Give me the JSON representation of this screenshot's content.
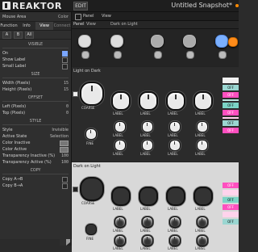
{
  "app": {
    "name": "REAKTOR",
    "edit_label": "EDIT",
    "snapshot_title": "Untitled Snapshot*"
  },
  "left_panel": {
    "header_left": "Mouse Area",
    "header_right": "Color",
    "tabs": [
      "Function",
      "Info",
      "View",
      "Connect"
    ],
    "active_tab": "View",
    "buttons": [
      "A",
      "B",
      "All"
    ],
    "sections": {
      "visible": "VISIBLE",
      "size": "SIZE",
      "offset": "OFFSET",
      "style": "STYLE",
      "copy": "COPY"
    },
    "visible_rows": [
      {
        "label": "On",
        "checked": true
      },
      {
        "label": "Show Label",
        "checked": false
      },
      {
        "label": "Small Label",
        "checked": false
      }
    ],
    "size_rows": [
      {
        "label": "Width (Pixels)",
        "value": "15"
      },
      {
        "label": "Height (Pixels)",
        "value": "15"
      }
    ],
    "offset_rows": [
      {
        "label": "Left (Pixels)",
        "value": "0"
      },
      {
        "label": "Top (Pixels)",
        "value": "0"
      }
    ],
    "style_rows": [
      {
        "label": "Style",
        "value": "Invisible"
      },
      {
        "label": "Active State",
        "value": "Selection"
      },
      {
        "label": "Color Inactive",
        "value": ""
      },
      {
        "label": "Color Active",
        "value": ""
      },
      {
        "label": "Transparency Inactive (%)",
        "value": "100"
      },
      {
        "label": "Transparency Active (%)",
        "value": "100"
      }
    ],
    "copy_rows": [
      {
        "label": "Copy A→B",
        "checked": false
      },
      {
        "label": "Copy B→A",
        "checked": false
      }
    ]
  },
  "right_panel": {
    "toolbar": {
      "panel_label": "Panel",
      "view_label": "View"
    },
    "breadcrumb": [
      "Panel",
      "View",
      "Dark on Light"
    ],
    "panels": [
      {
        "title": "Light on Dark",
        "coarse_label": "COARSE",
        "fine_label": "FINE",
        "knob_label": "LABEL",
        "off_label": "OFF"
      },
      {
        "title": "Dark on Light",
        "coarse_label": "COARSE",
        "fine_label": "FINE",
        "knob_label": "LABEL",
        "off_label": "OFF"
      }
    ]
  }
}
